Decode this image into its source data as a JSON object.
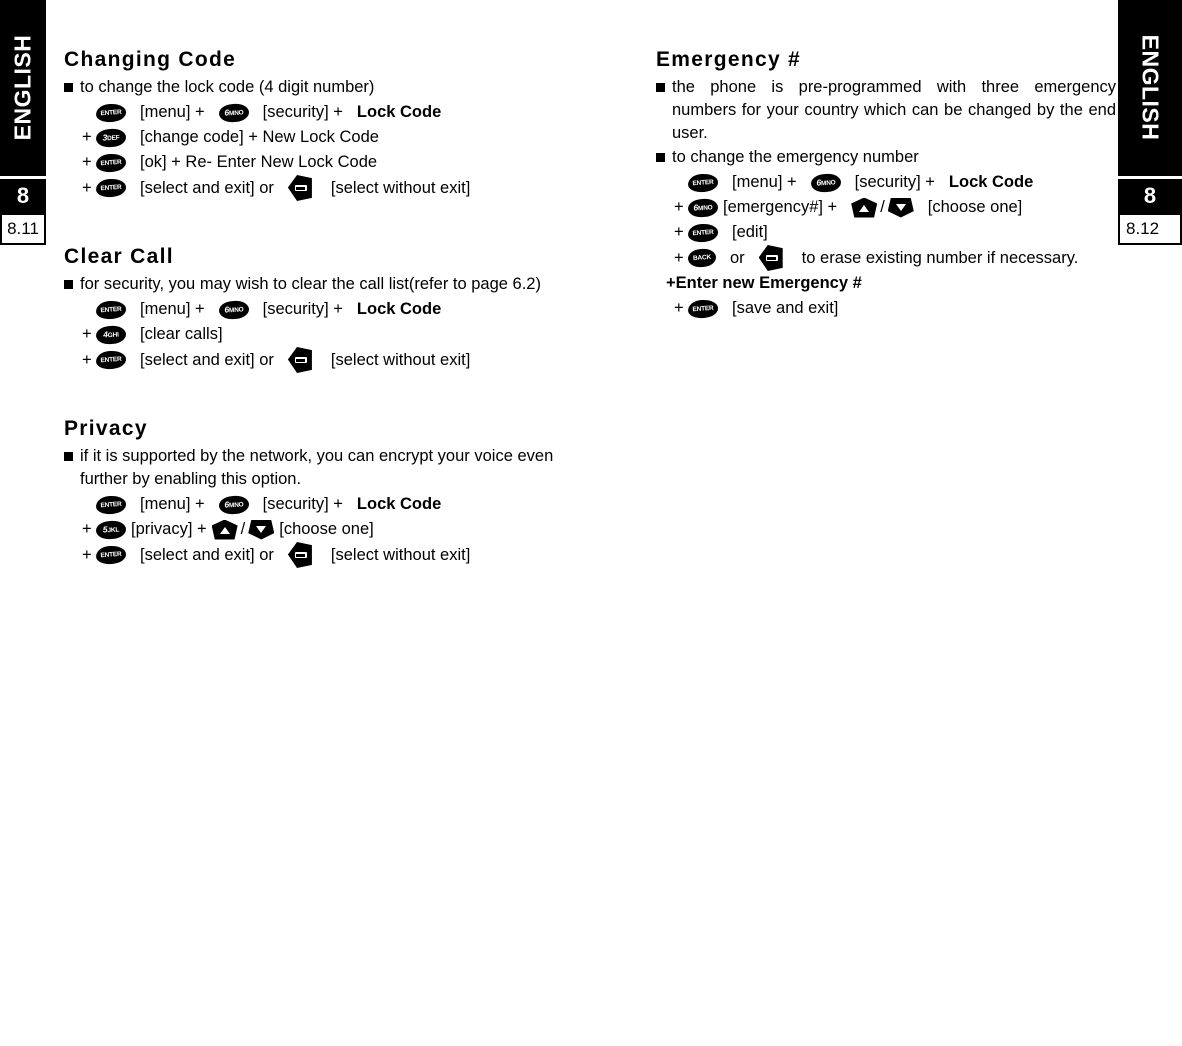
{
  "sidebar_left": {
    "language": "ENGLISH",
    "chapter": "8",
    "page": "8.11"
  },
  "sidebar_right": {
    "language": "ENGLISH",
    "chapter": "8",
    "page": "8.12"
  },
  "left_column": {
    "sections": [
      {
        "title": "Changing Code",
        "bullet": "to change the lock code (4 digit number)",
        "steps": [
          {
            "plus": "",
            "key": "ENTER",
            "text1": "[menu] +",
            "key2": "6MNO",
            "text2": "[security] +",
            "bold": "Lock Code"
          },
          {
            "plus": "+",
            "key": "3DEF",
            "text1": "[change code] + New Lock Code"
          },
          {
            "plus": "+",
            "key": "ENTER",
            "text1": "[ok] + Re- Enter New Lock Code"
          },
          {
            "plus": "+",
            "key": "ENTER",
            "text1": "[select and exit] or",
            "key2": "CLR",
            "text2": "[select without exit]"
          }
        ]
      },
      {
        "title": "Clear Call",
        "bullet": "for security, you may wish to clear the call list(refer to page 6.2)",
        "steps": [
          {
            "plus": "",
            "key": "ENTER",
            "text1": "[menu] +",
            "key2": "6MNO",
            "text2": "[security] +",
            "bold": "Lock Code"
          },
          {
            "plus": "+",
            "key": "4GHI",
            "text1": "[clear calls]"
          },
          {
            "plus": "+",
            "key": "ENTER",
            "text1": "[select and exit] or",
            "key2": "CLR",
            "text2": "[select without exit]"
          }
        ]
      },
      {
        "title": "Privacy",
        "bullet": "if it is supported by the network, you can encrypt your voice even further by enabling this option.",
        "steps": [
          {
            "plus": "",
            "key": "ENTER",
            "text1": "[menu] +",
            "key2": "6MNO",
            "text2": "[security] +",
            "bold": "Lock Code"
          },
          {
            "plus": "+",
            "key": "5JKL",
            "text1": "[privacy] +",
            "key_up": "UP",
            "slash": "/",
            "key_down": "DOWN",
            "text2": "[choose one]"
          },
          {
            "plus": "+",
            "key": "ENTER",
            "text1": "[select and exit] or",
            "key2": "CLR",
            "text2": "[select without exit]"
          }
        ]
      }
    ]
  },
  "right_column": {
    "sections": [
      {
        "title": "Emergency #",
        "bullets": [
          "the phone is pre-programmed with three emergency numbers for your country which can be changed by the end user.",
          "to change the emergency number"
        ],
        "steps": [
          {
            "plus": "",
            "key": "ENTER",
            "text1": "[menu] +",
            "key2": "6MNO",
            "text2": "[security] +",
            "bold": "Lock Code"
          },
          {
            "plus": "+",
            "key": "6MNO",
            "text1": "[emergency#] +",
            "key_up": "UP",
            "slash": "/",
            "key_down": "DOWN",
            "text2": "[choose one]"
          },
          {
            "plus": "+",
            "key": "ENTER",
            "text1": "[edit]"
          },
          {
            "plus": "+",
            "key": "BACK",
            "text1": "or",
            "key2": "CLR",
            "text2": "to erase existing number if necessary."
          }
        ],
        "bold_line": "+Enter new Emergency #",
        "last_step": {
          "plus": "+",
          "key": "ENTER",
          "text1": "[save and exit]"
        }
      }
    ]
  },
  "key_labels": {
    "ENTER": "ENTER",
    "BACK": "BACK",
    "6MNO": {
      "num": "6",
      "alpha": "MNO"
    },
    "3DEF": {
      "num": "3",
      "alpha": "DEF"
    },
    "4GHI": {
      "num": "4",
      "alpha": "GHI"
    },
    "5JKL": {
      "num": "5",
      "alpha": "JKL"
    },
    "CLR": "CLR"
  },
  "colors": {
    "ink": "#000000",
    "paper": "#ffffff"
  }
}
